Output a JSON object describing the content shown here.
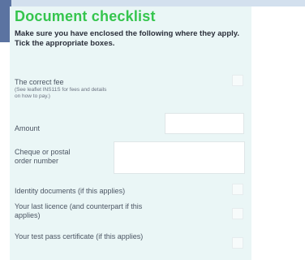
{
  "title": "Document checklist",
  "intro": "Make sure you have enclosed the following where they apply. Tick the appropriate boxes.",
  "fields": {
    "fee_label": "The correct fee",
    "fee_note": "(See leaflet INS11S for fees and details on how to pay.)",
    "amount_label": "Amount",
    "cheque_label": "Cheque or postal order number",
    "identity_label": "Identity documents (if this applies)",
    "licence_label": "Your last licence (and counterpart if this applies)",
    "testpass_label": "Your test pass certificate (if this applies)"
  },
  "colors": {
    "title": "#35c54d",
    "form_bg": "#eaf6f6",
    "accent_band": "#5b73a1"
  }
}
